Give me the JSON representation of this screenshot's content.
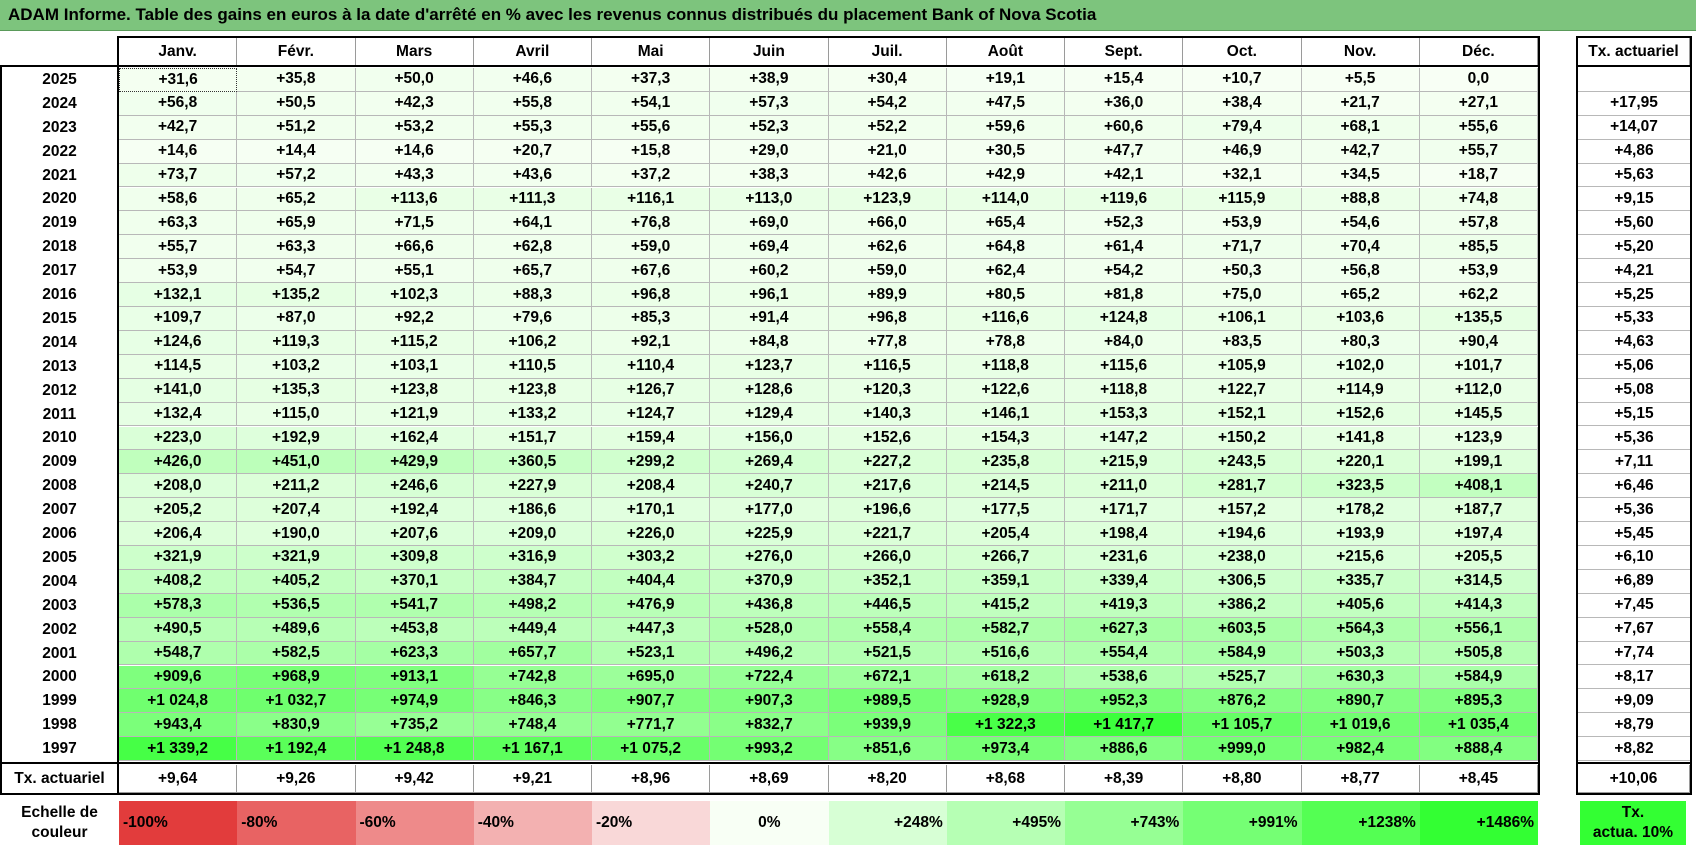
{
  "title": "ADAM Informe. Table des gains en euros à la date d'arrêté en % avec les revenus connus distribués du placement Bank of Nova Scotia",
  "colors": {
    "title_bg": "#7dc47d",
    "max_green": "#33ff33",
    "max_red": "#e23c3c",
    "zero": "#ffffff"
  },
  "chart_data": {
    "type": "table",
    "columns": [
      "Janv.",
      "Févr.",
      "Mars",
      "Avril",
      "Mai",
      "Juin",
      "Juil.",
      "Août",
      "Sept.",
      "Oct.",
      "Nov.",
      "Déc."
    ],
    "rate_column_header": "Tx. actuariel",
    "rows": [
      {
        "year": "2025",
        "values": [
          "+31,6",
          "+35,8",
          "+50,0",
          "+46,6",
          "+37,3",
          "+38,9",
          "+30,4",
          "+19,1",
          "+15,4",
          "+10,7",
          "+5,5",
          "0,0"
        ],
        "rate": ""
      },
      {
        "year": "2024",
        "values": [
          "+56,8",
          "+50,5",
          "+42,3",
          "+55,8",
          "+54,1",
          "+57,3",
          "+54,2",
          "+47,5",
          "+36,0",
          "+38,4",
          "+21,7",
          "+27,1"
        ],
        "rate": "+17,95"
      },
      {
        "year": "2023",
        "values": [
          "+42,7",
          "+51,2",
          "+53,2",
          "+55,3",
          "+55,6",
          "+52,3",
          "+52,2",
          "+59,6",
          "+60,6",
          "+79,4",
          "+68,1",
          "+55,6"
        ],
        "rate": "+14,07"
      },
      {
        "year": "2022",
        "values": [
          "+14,6",
          "+14,4",
          "+14,6",
          "+20,7",
          "+15,8",
          "+29,0",
          "+21,0",
          "+30,5",
          "+47,7",
          "+46,9",
          "+42,7",
          "+55,7"
        ],
        "rate": "+4,86"
      },
      {
        "year": "2021",
        "values": [
          "+73,7",
          "+57,2",
          "+43,3",
          "+43,6",
          "+37,2",
          "+38,3",
          "+42,6",
          "+42,9",
          "+42,1",
          "+32,1",
          "+34,5",
          "+18,7"
        ],
        "rate": "+5,63"
      },
      {
        "year": "2020",
        "values": [
          "+58,6",
          "+65,2",
          "+113,6",
          "+111,3",
          "+116,1",
          "+113,0",
          "+123,9",
          "+114,0",
          "+119,6",
          "+115,9",
          "+88,8",
          "+74,8"
        ],
        "rate": "+9,15"
      },
      {
        "year": "2019",
        "values": [
          "+63,3",
          "+65,9",
          "+71,5",
          "+64,1",
          "+76,8",
          "+69,0",
          "+66,0",
          "+65,4",
          "+52,3",
          "+53,9",
          "+54,6",
          "+57,8"
        ],
        "rate": "+5,60"
      },
      {
        "year": "2018",
        "values": [
          "+55,7",
          "+63,3",
          "+66,6",
          "+62,8",
          "+59,0",
          "+69,4",
          "+62,6",
          "+64,8",
          "+61,4",
          "+71,7",
          "+70,4",
          "+85,5"
        ],
        "rate": "+5,20"
      },
      {
        "year": "2017",
        "values": [
          "+53,9",
          "+54,7",
          "+55,1",
          "+65,7",
          "+67,6",
          "+60,2",
          "+59,0",
          "+62,4",
          "+54,2",
          "+50,3",
          "+56,8",
          "+53,9"
        ],
        "rate": "+4,21"
      },
      {
        "year": "2016",
        "values": [
          "+132,1",
          "+135,2",
          "+102,3",
          "+88,3",
          "+96,8",
          "+96,1",
          "+89,9",
          "+80,5",
          "+81,8",
          "+75,0",
          "+65,2",
          "+62,2"
        ],
        "rate": "+5,25"
      },
      {
        "year": "2015",
        "values": [
          "+109,7",
          "+87,0",
          "+92,2",
          "+79,6",
          "+85,3",
          "+91,4",
          "+96,8",
          "+116,6",
          "+124,8",
          "+106,1",
          "+103,6",
          "+135,5"
        ],
        "rate": "+5,33"
      },
      {
        "year": "2014",
        "values": [
          "+124,6",
          "+119,3",
          "+115,2",
          "+106,2",
          "+92,1",
          "+84,8",
          "+77,8",
          "+78,8",
          "+84,0",
          "+83,5",
          "+80,3",
          "+90,4"
        ],
        "rate": "+4,63"
      },
      {
        "year": "2013",
        "values": [
          "+114,5",
          "+103,2",
          "+103,1",
          "+110,5",
          "+110,4",
          "+123,7",
          "+116,5",
          "+118,8",
          "+115,6",
          "+105,9",
          "+102,0",
          "+101,7"
        ],
        "rate": "+5,06"
      },
      {
        "year": "2012",
        "values": [
          "+141,0",
          "+135,3",
          "+123,8",
          "+123,8",
          "+126,7",
          "+128,6",
          "+120,3",
          "+122,6",
          "+118,8",
          "+122,7",
          "+114,9",
          "+112,0"
        ],
        "rate": "+5,08"
      },
      {
        "year": "2011",
        "values": [
          "+132,4",
          "+115,0",
          "+121,9",
          "+133,2",
          "+124,7",
          "+129,4",
          "+140,3",
          "+146,1",
          "+153,3",
          "+152,1",
          "+152,6",
          "+145,5"
        ],
        "rate": "+5,15"
      },
      {
        "year": "2010",
        "values": [
          "+223,0",
          "+192,9",
          "+162,4",
          "+151,7",
          "+159,4",
          "+156,0",
          "+152,6",
          "+154,3",
          "+147,2",
          "+150,2",
          "+141,8",
          "+123,9"
        ],
        "rate": "+5,36"
      },
      {
        "year": "2009",
        "values": [
          "+426,0",
          "+451,0",
          "+429,9",
          "+360,5",
          "+299,2",
          "+269,4",
          "+227,2",
          "+235,8",
          "+215,9",
          "+243,5",
          "+220,1",
          "+199,1"
        ],
        "rate": "+7,11"
      },
      {
        "year": "2008",
        "values": [
          "+208,0",
          "+211,2",
          "+246,6",
          "+227,9",
          "+208,4",
          "+240,7",
          "+217,6",
          "+214,5",
          "+211,0",
          "+281,7",
          "+323,5",
          "+408,1"
        ],
        "rate": "+6,46"
      },
      {
        "year": "2007",
        "values": [
          "+205,2",
          "+207,4",
          "+192,4",
          "+186,6",
          "+170,1",
          "+177,0",
          "+196,6",
          "+177,5",
          "+171,7",
          "+157,2",
          "+178,2",
          "+187,7"
        ],
        "rate": "+5,36"
      },
      {
        "year": "2006",
        "values": [
          "+206,4",
          "+190,0",
          "+207,6",
          "+209,0",
          "+226,0",
          "+225,9",
          "+221,7",
          "+205,4",
          "+198,4",
          "+194,6",
          "+193,9",
          "+197,4"
        ],
        "rate": "+5,45"
      },
      {
        "year": "2005",
        "values": [
          "+321,9",
          "+321,9",
          "+309,8",
          "+316,9",
          "+303,2",
          "+276,0",
          "+266,0",
          "+266,7",
          "+231,6",
          "+238,0",
          "+215,6",
          "+205,5"
        ],
        "rate": "+6,10"
      },
      {
        "year": "2004",
        "values": [
          "+408,2",
          "+405,2",
          "+370,1",
          "+384,7",
          "+404,4",
          "+370,9",
          "+352,1",
          "+359,1",
          "+339,4",
          "+306,5",
          "+335,7",
          "+314,5"
        ],
        "rate": "+6,89"
      },
      {
        "year": "2003",
        "values": [
          "+578,3",
          "+536,5",
          "+541,7",
          "+498,2",
          "+476,9",
          "+436,8",
          "+446,5",
          "+415,2",
          "+419,3",
          "+386,2",
          "+405,6",
          "+414,3"
        ],
        "rate": "+7,45"
      },
      {
        "year": "2002",
        "values": [
          "+490,5",
          "+489,6",
          "+453,8",
          "+449,4",
          "+447,3",
          "+528,0",
          "+558,4",
          "+582,7",
          "+627,3",
          "+603,5",
          "+564,3",
          "+556,1"
        ],
        "rate": "+7,67"
      },
      {
        "year": "2001",
        "values": [
          "+548,7",
          "+582,5",
          "+623,3",
          "+657,7",
          "+523,1",
          "+496,2",
          "+521,5",
          "+516,6",
          "+554,4",
          "+584,9",
          "+503,3",
          "+505,8"
        ],
        "rate": "+7,74"
      },
      {
        "year": "2000",
        "values": [
          "+909,6",
          "+968,9",
          "+913,1",
          "+742,8",
          "+695,0",
          "+722,4",
          "+672,1",
          "+618,2",
          "+538,6",
          "+525,7",
          "+630,3",
          "+584,9"
        ],
        "rate": "+8,17"
      },
      {
        "year": "1999",
        "values": [
          "+1 024,8",
          "+1 032,7",
          "+974,9",
          "+846,3",
          "+907,7",
          "+907,3",
          "+989,5",
          "+928,9",
          "+952,3",
          "+876,2",
          "+890,7",
          "+895,3"
        ],
        "rate": "+9,09"
      },
      {
        "year": "1998",
        "values": [
          "+943,4",
          "+830,9",
          "+735,2",
          "+748,4",
          "+771,7",
          "+832,7",
          "+939,9",
          "+1 322,3",
          "+1 417,7",
          "+1 105,7",
          "+1 019,6",
          "+1 035,4"
        ],
        "rate": "+8,79"
      },
      {
        "year": "1997",
        "values": [
          "+1 339,2",
          "+1 192,4",
          "+1 248,8",
          "+1 167,1",
          "+1 075,2",
          "+993,2",
          "+851,6",
          "+973,4",
          "+886,6",
          "+999,0",
          "+982,4",
          "+888,4"
        ],
        "rate": "+8,82"
      }
    ],
    "footer": {
      "label": "Tx. actuariel",
      "values": [
        "+9,64",
        "+9,26",
        "+9,42",
        "+9,21",
        "+8,96",
        "+8,69",
        "+8,20",
        "+8,68",
        "+8,39",
        "+8,80",
        "+8,77",
        "+8,45"
      ],
      "overall": "+10,06"
    },
    "color_scale": {
      "label_line1": "Echelle de",
      "label_line2": "couleur",
      "stops": [
        {
          "text": "-100%",
          "value": -100
        },
        {
          "text": "-80%",
          "value": -80
        },
        {
          "text": "-60%",
          "value": -60
        },
        {
          "text": "-40%",
          "value": -40
        },
        {
          "text": "-20%",
          "value": -20
        },
        {
          "text": "0%",
          "value": 0
        },
        {
          "text": "+248%",
          "value": 248
        },
        {
          "text": "+495%",
          "value": 495
        },
        {
          "text": "+743%",
          "value": 743
        },
        {
          "text": "+991%",
          "value": 991
        },
        {
          "text": "+1238%",
          "value": 1238
        },
        {
          "text": "+1486%",
          "value": 1486
        }
      ],
      "rate_legend_line1": "Tx.",
      "rate_legend_line2": "actua. 10%"
    }
  }
}
